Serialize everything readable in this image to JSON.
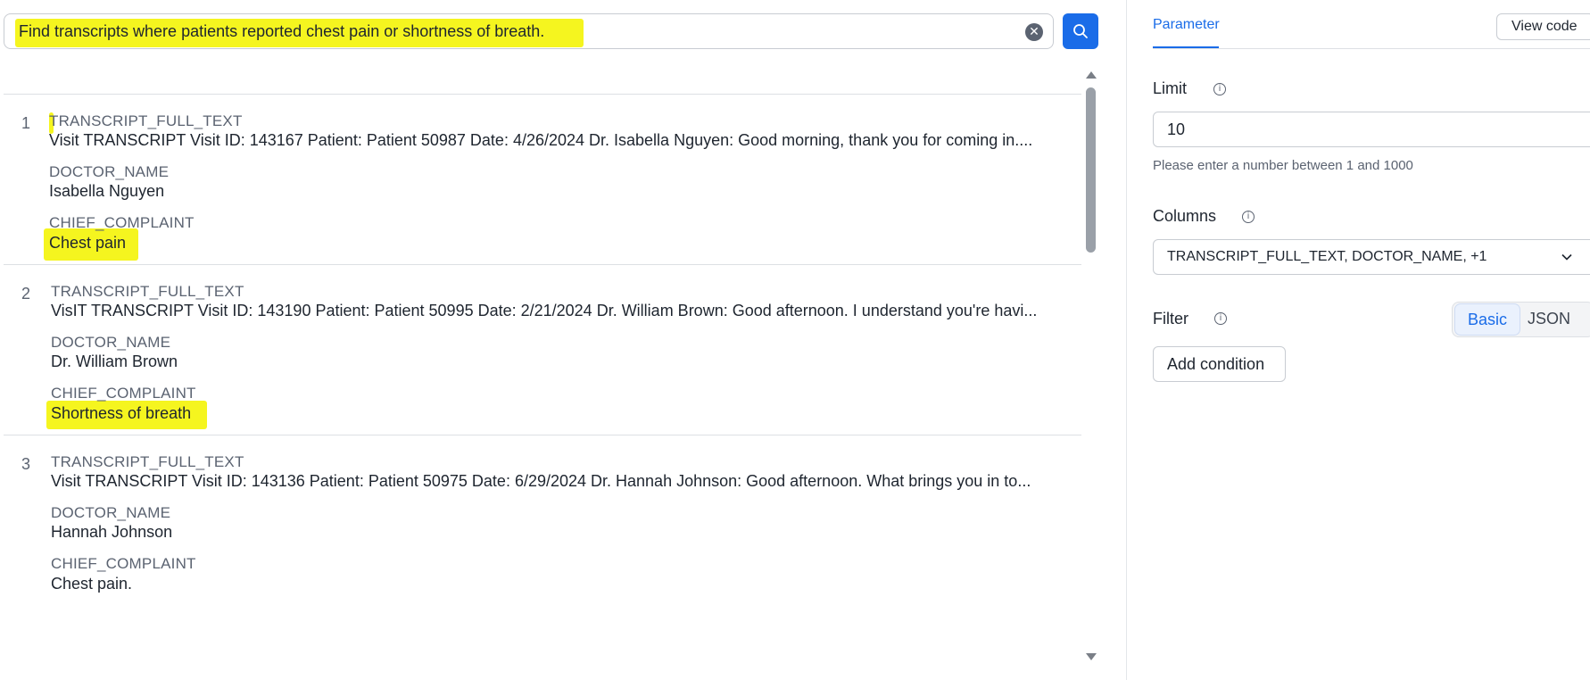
{
  "search": {
    "query": "Find transcripts where patients reported chest pain or shortness of breath.",
    "clear_icon": "close-circle-icon",
    "search_icon": "search-icon"
  },
  "results": [
    {
      "index": "1",
      "fields": [
        {
          "label": "TRANSCRIPT_FULL_TEXT",
          "value": "Visit TRANSCRIPT Visit ID: 143167 Patient: Patient 50987 Date: 4/26/2024 Dr. Isabella Nguyen: Good morning, thank you for coming in...."
        },
        {
          "label": "DOCTOR_NAME",
          "value": "Isabella Nguyen"
        },
        {
          "label": "CHIEF_COMPLAINT",
          "value": "Chest pain"
        }
      ]
    },
    {
      "index": "2",
      "fields": [
        {
          "label": "TRANSCRIPT_FULL_TEXT",
          "value": "VisIT TRANSCRIPT Visit ID: 143190 Patient: Patient 50995 Date: 2/21/2024 Dr. William Brown: Good afternoon. I understand you're havi..."
        },
        {
          "label": "DOCTOR_NAME",
          "value": "Dr. William Brown"
        },
        {
          "label": "CHIEF_COMPLAINT",
          "value": "Shortness of breath"
        }
      ]
    },
    {
      "index": "3",
      "fields": [
        {
          "label": "TRANSCRIPT_FULL_TEXT",
          "value": "Visit TRANSCRIPT Visit ID: 143136 Patient: Patient 50975 Date: 6/29/2024 Dr. Hannah Johnson: Good afternoon. What brings you in to..."
        },
        {
          "label": "DOCTOR_NAME",
          "value": "Hannah Johnson"
        },
        {
          "label": "CHIEF_COMPLAINT",
          "value": "Chest pain."
        }
      ]
    }
  ],
  "panel": {
    "tab_parameter": "Parameter",
    "view_code": "View code",
    "limit_label": "Limit",
    "limit_value": "10",
    "limit_helper": "Please enter a number between 1 and 1000",
    "columns_label": "Columns",
    "columns_value": "TRANSCRIPT_FULL_TEXT, DOCTOR_NAME, +1",
    "filter_label": "Filter",
    "filter_basic": "Basic",
    "filter_json": "JSON",
    "add_condition": "Add condition",
    "info_icon": "info-icon"
  },
  "colors": {
    "accent": "#1a6ce8",
    "highlight": "#f5f51f"
  }
}
